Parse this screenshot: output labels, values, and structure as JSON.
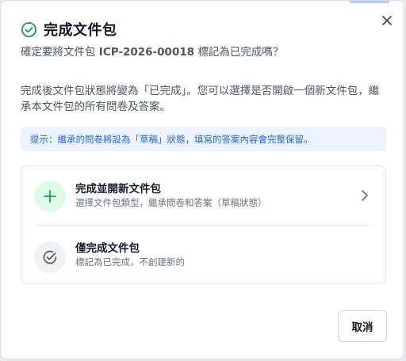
{
  "dialog": {
    "title": "完成文件包",
    "subtitle_prefix": "確定要將文件包 ",
    "package_code": "ICP-2026-00018",
    "subtitle_suffix": " 標記為已完成嗎？",
    "description": "完成後文件包狀態將變為「已完成」。您可以選擇是否開啟一個新文件包，繼承本文件包的所有問卷及答案。",
    "hint": "提示：繼承的問卷將設為「草稿」狀態，填寫的答案內容會完整保留。",
    "options": [
      {
        "title": "完成並開新文件包",
        "subtitle": "選擇文件包類型，繼承問卷和答案（草稿狀態）",
        "icon": "plus-icon"
      },
      {
        "title": "僅完成文件包",
        "subtitle": "標記為已完成，不創建新的",
        "icon": "check-circle-icon"
      }
    ],
    "cancel_label": "取消"
  },
  "colors": {
    "success": "#16a34a",
    "hint_text": "#2563eb",
    "hint_bg": "#eef4ff"
  }
}
